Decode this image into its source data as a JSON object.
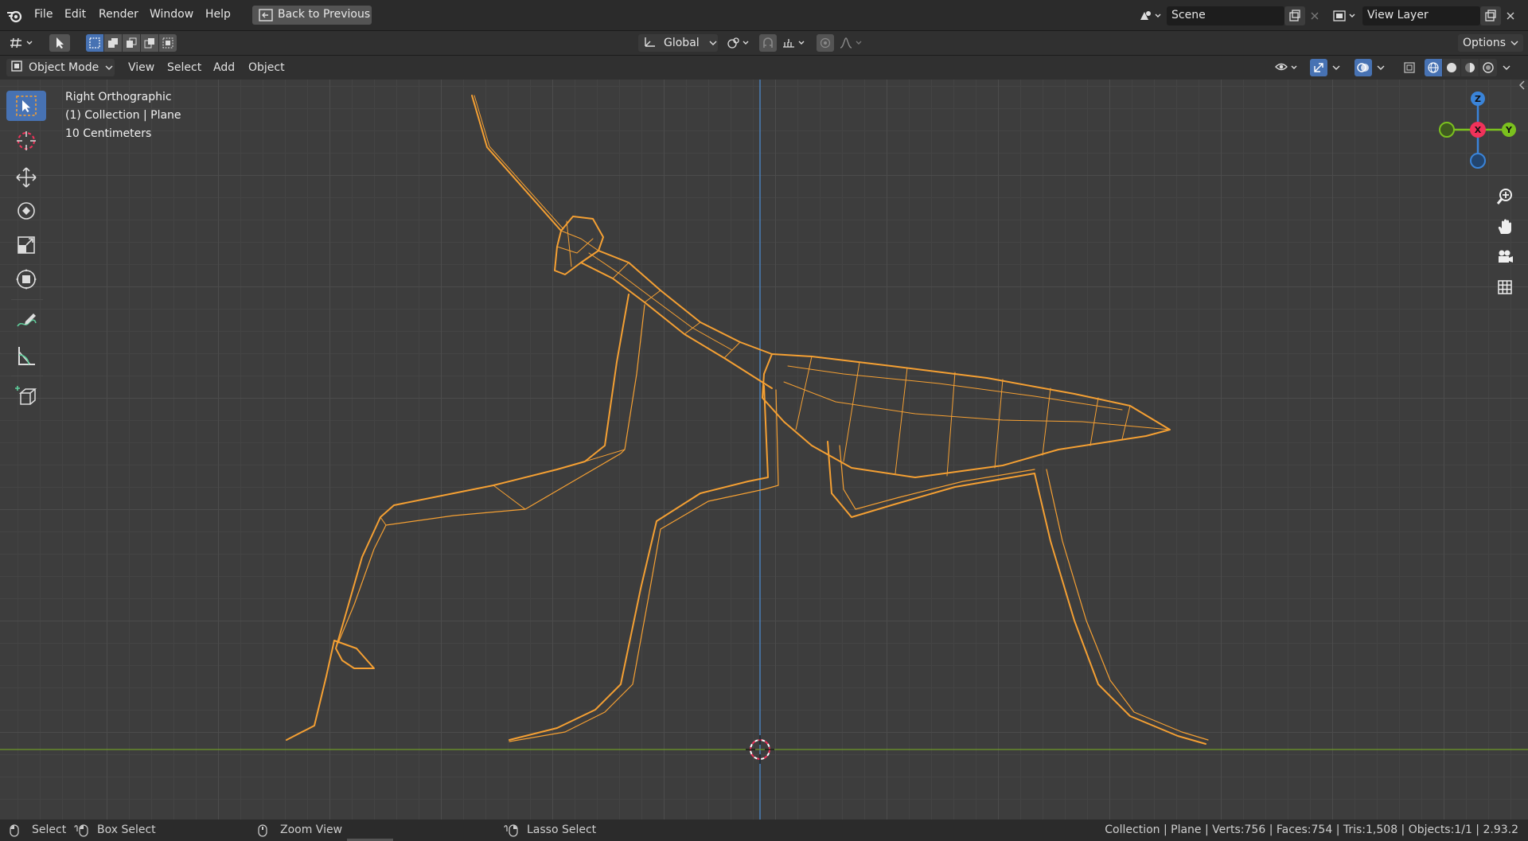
{
  "app": {
    "logo": "blender-logo"
  },
  "menu": {
    "file": "File",
    "edit": "Edit",
    "render": "Render",
    "window": "Window",
    "help": "Help"
  },
  "topbar": {
    "back_label": "Back to Previous",
    "scene": "Scene",
    "view_layer": "View Layer"
  },
  "toolrow": {
    "orientation": "Global",
    "options": "Options"
  },
  "header": {
    "mode": "Object Mode",
    "view": "View",
    "select": "Select",
    "add": "Add",
    "object": "Object"
  },
  "overlay": {
    "view_name": "Right Orthographic",
    "collection": "(1) Collection | Plane",
    "scale": "10 Centimeters"
  },
  "gizmo": {
    "z": "Z",
    "x": "X",
    "y": "Y"
  },
  "status": {
    "select": "Select",
    "box_select": "Box Select",
    "zoom_view": "Zoom View",
    "lasso_select": "Lasso Select",
    "stats": "Collection | Plane | Verts:756 | Faces:754 | Tris:1,508 | Objects:1/1 | 2.93.2"
  },
  "colors": {
    "accent": "#4772b3",
    "wire": "#f5a033",
    "x_axis": "#f1325a",
    "y_axis": "#7bc11e",
    "z_axis": "#3a84d9",
    "ground_line": "#6f9a2a",
    "vertical_line": "#4a7fb8"
  }
}
